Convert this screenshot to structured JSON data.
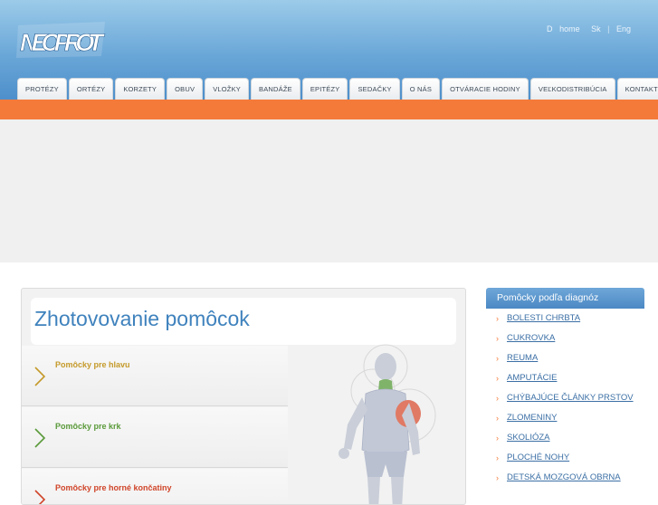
{
  "brand": {
    "logo_text": "NEOPROT"
  },
  "toplinks": {
    "home": "home",
    "sk": "Sk",
    "separator": "|",
    "eng": "Eng"
  },
  "nav": [
    "PROTÉZY",
    "ORTÉZY",
    "KORZETY",
    "OBUV",
    "VLOŽKY",
    "BANDÁŽE",
    "EPITÉZY",
    "SEDAČKY",
    "O NÁS",
    "OTVÁRACIE HODINY",
    "VEĽKODISTRIBÚCIA",
    "KONTAKT"
  ],
  "main": {
    "title": "Zhotovovanie pomôcok",
    "categories": [
      {
        "label": "Pomôcky pre hlavu",
        "color": "#c59a2a"
      },
      {
        "label": "Pomôcky pre krk",
        "color": "#5a9a3a"
      },
      {
        "label": "Pomôcky pre horné končatiny",
        "color": "#d0452a"
      }
    ]
  },
  "sidebar": {
    "title": "Pomôcky podľa diagnóz",
    "items": [
      "BOLESTI CHRBTA",
      "CUKROVKA",
      "REUMA",
      "AMPUTÁCIE",
      "CHÝBAJÚCE ČLÁNKY PRSTOV",
      "ZLOMENINY",
      "SKOLIÓZA",
      "PLOCHÉ NOHY",
      "DETSKÁ MOZGOVÁ OBRNA"
    ]
  },
  "colors": {
    "accent_orange": "#f47a3a",
    "header_blue": "#5b9bd2",
    "title_blue": "#3f82bd"
  }
}
